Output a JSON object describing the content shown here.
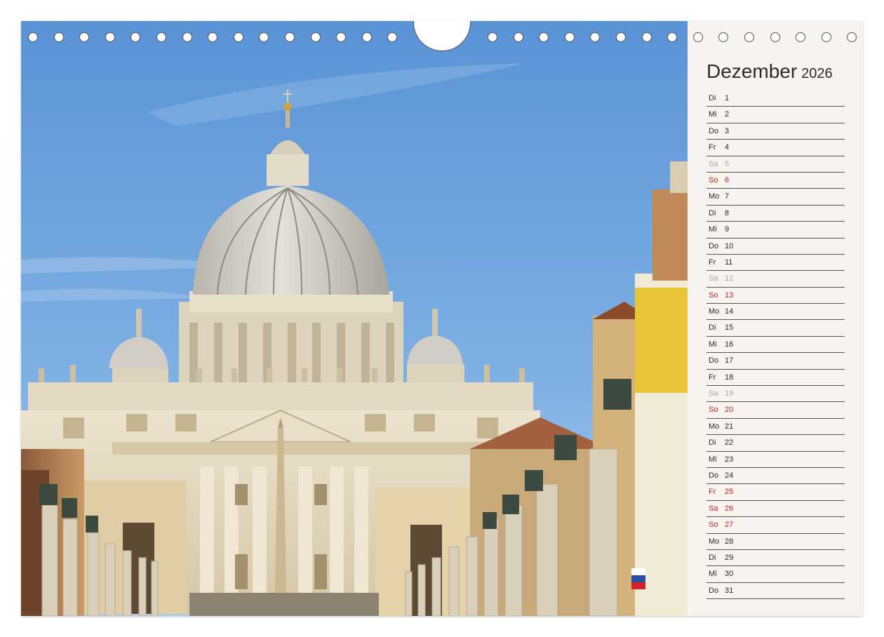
{
  "calendar": {
    "month": "Dezember",
    "year": "2026",
    "days": [
      {
        "wd": "Di",
        "num": "1",
        "type": "weekday"
      },
      {
        "wd": "Mi",
        "num": "2",
        "type": "weekday"
      },
      {
        "wd": "Do",
        "num": "3",
        "type": "weekday"
      },
      {
        "wd": "Fr",
        "num": "4",
        "type": "weekday"
      },
      {
        "wd": "Sa",
        "num": "5",
        "type": "sat"
      },
      {
        "wd": "So",
        "num": "6",
        "type": "sun"
      },
      {
        "wd": "Mo",
        "num": "7",
        "type": "weekday"
      },
      {
        "wd": "Di",
        "num": "8",
        "type": "weekday"
      },
      {
        "wd": "Mi",
        "num": "9",
        "type": "weekday"
      },
      {
        "wd": "Do",
        "num": "10",
        "type": "weekday"
      },
      {
        "wd": "Fr",
        "num": "11",
        "type": "weekday"
      },
      {
        "wd": "Sa",
        "num": "12",
        "type": "sat"
      },
      {
        "wd": "So",
        "num": "13",
        "type": "sun"
      },
      {
        "wd": "Mo",
        "num": "14",
        "type": "weekday"
      },
      {
        "wd": "Di",
        "num": "15",
        "type": "weekday"
      },
      {
        "wd": "Mi",
        "num": "16",
        "type": "weekday"
      },
      {
        "wd": "Do",
        "num": "17",
        "type": "weekday"
      },
      {
        "wd": "Fr",
        "num": "18",
        "type": "weekday"
      },
      {
        "wd": "Sa",
        "num": "19",
        "type": "sat"
      },
      {
        "wd": "So",
        "num": "20",
        "type": "sun"
      },
      {
        "wd": "Mo",
        "num": "21",
        "type": "weekday"
      },
      {
        "wd": "Di",
        "num": "22",
        "type": "weekday"
      },
      {
        "wd": "Mi",
        "num": "23",
        "type": "weekday"
      },
      {
        "wd": "Do",
        "num": "24",
        "type": "weekday"
      },
      {
        "wd": "Fr",
        "num": "25",
        "type": "holiday"
      },
      {
        "wd": "Sa",
        "num": "26",
        "type": "holiday"
      },
      {
        "wd": "So",
        "num": "27",
        "type": "sun"
      },
      {
        "wd": "Mo",
        "num": "28",
        "type": "weekday"
      },
      {
        "wd": "Di",
        "num": "29",
        "type": "weekday"
      },
      {
        "wd": "Mi",
        "num": "30",
        "type": "weekday"
      },
      {
        "wd": "Do",
        "num": "31",
        "type": "weekday"
      }
    ]
  },
  "colors": {
    "sky_top": "#5b95d8",
    "sky_bottom": "#9cc3ea",
    "stone": "#e6dcc7",
    "stone_shadow": "#c9b994",
    "dome": "#d9d6cf",
    "sunday_red": "#c0222b",
    "saturday_grey": "#a8a8a8",
    "page_bg": "#f7f4ef"
  },
  "binding": {
    "hole_count_left": 15,
    "hole_count_right": 15
  }
}
